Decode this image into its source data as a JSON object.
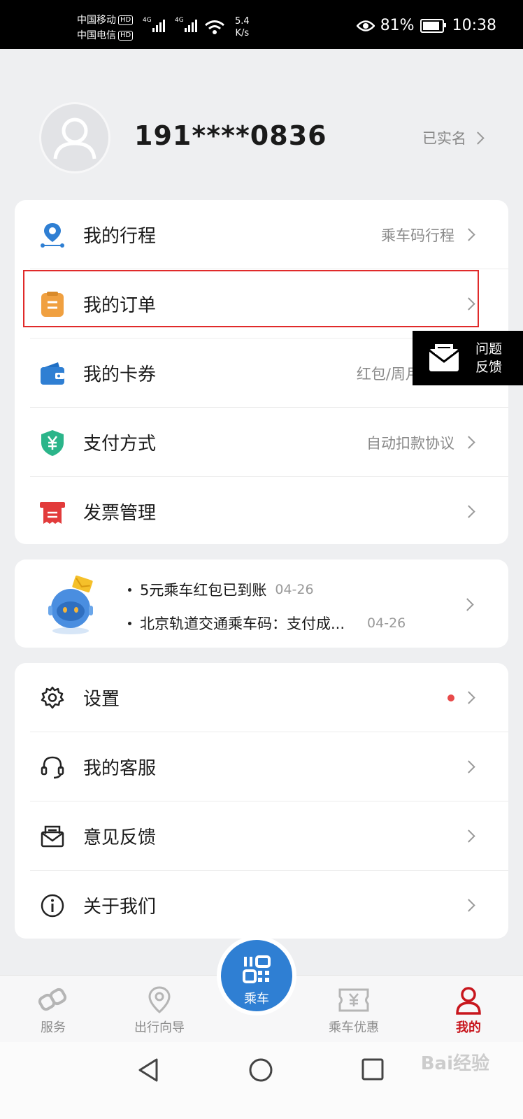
{
  "status_bar": {
    "carrier1": "中国移动",
    "carrier2": "中国电信",
    "hd": "HD",
    "net1": "4G",
    "net2": "4G",
    "speed_value": "5.4",
    "speed_unit": "K/s",
    "battery": "81%",
    "time": "10:38"
  },
  "profile": {
    "phone": "191****0836",
    "verified": "已实名"
  },
  "menu": [
    {
      "label": "我的行程",
      "right": "乘车码行程",
      "icon": "location-pin-icon"
    },
    {
      "label": "我的订单",
      "right": "",
      "icon": "order-clipboard-icon"
    },
    {
      "label": "我的卡券",
      "right": "红包/周月卡/地",
      "icon": "wallet-icon"
    },
    {
      "label": "支付方式",
      "right": "自动扣款协议",
      "icon": "yuan-shield-icon"
    },
    {
      "label": "发票管理",
      "right": "",
      "icon": "invoice-icon"
    }
  ],
  "feedback_float": {
    "line1": "问题",
    "line2": "反馈"
  },
  "messages": [
    {
      "text": "5元乘车红包已到账",
      "date": "04-26"
    },
    {
      "text": "北京轨道交通乘车码：支付成...",
      "date": "04-26"
    }
  ],
  "settings_menu": [
    {
      "label": "设置",
      "icon": "gear-icon",
      "badge": true
    },
    {
      "label": "我的客服",
      "icon": "headset-icon",
      "badge": false
    },
    {
      "label": "意见反馈",
      "icon": "feedback-envelope-icon",
      "badge": false
    },
    {
      "label": "关于我们",
      "icon": "info-icon",
      "badge": false
    }
  ],
  "bottom_nav": {
    "service": "服务",
    "guide": "出行向导",
    "ride": "乘车",
    "offers": "乘车优惠",
    "mine": "我的"
  },
  "colors": {
    "accent_red": "#c8161d",
    "ride_blue": "#2f7fd3",
    "highlight_border": "#e02a2a"
  },
  "watermark": "Bai经验"
}
